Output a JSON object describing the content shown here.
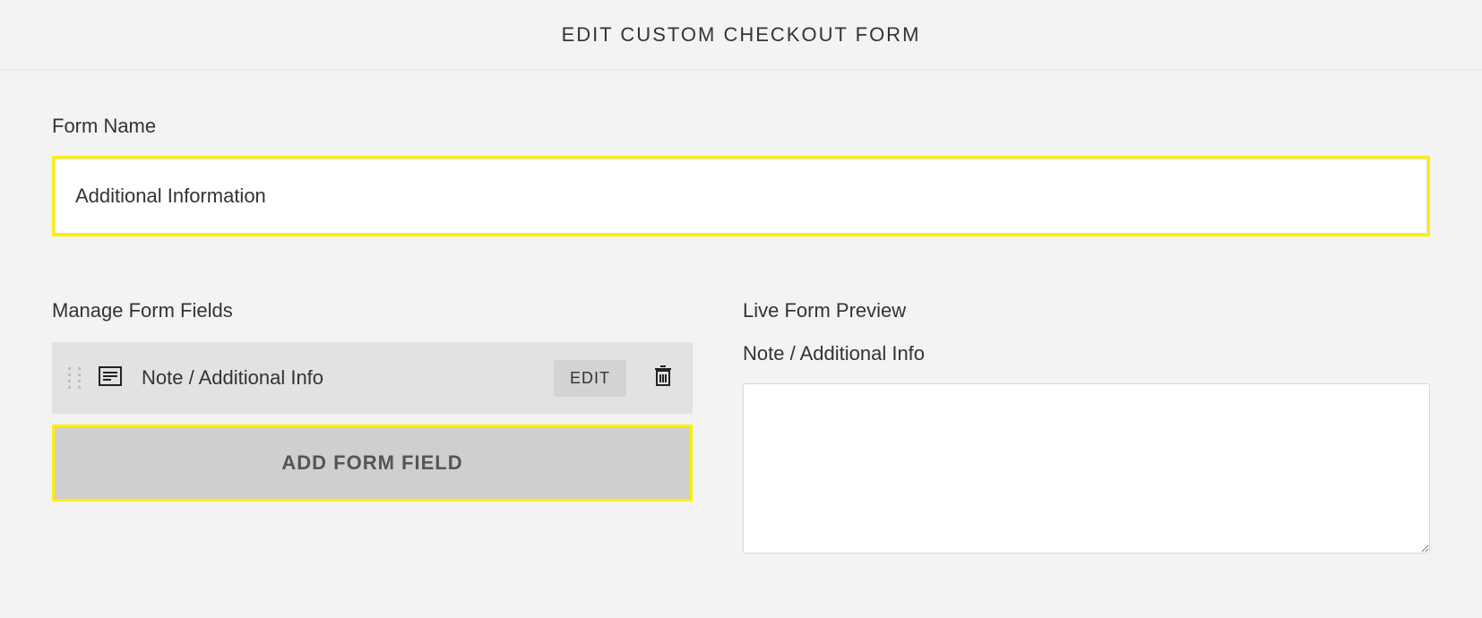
{
  "header": {
    "title": "EDIT CUSTOM CHECKOUT FORM"
  },
  "form_name": {
    "label": "Form Name",
    "value": "Additional Information"
  },
  "manage": {
    "heading": "Manage Form Fields",
    "fields": [
      {
        "label": "Note / Additional Info",
        "edit_label": "EDIT"
      }
    ],
    "add_button": "ADD FORM FIELD"
  },
  "preview": {
    "heading": "Live Form Preview",
    "field_label": "Note / Additional Info",
    "value": ""
  }
}
